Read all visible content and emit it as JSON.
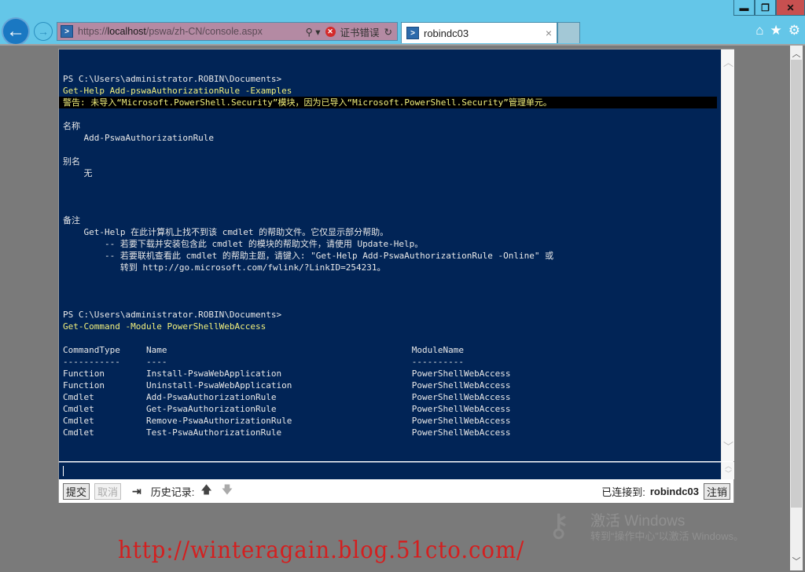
{
  "browser": {
    "window_controls": {
      "minimize": "▬",
      "restore": "❐",
      "close": "✕"
    },
    "address_bar": {
      "url_prefix": "https://",
      "url_host": "localhost",
      "url_path": "/pswa/zh-CN/console.aspx",
      "cert_error_label": "证书错误",
      "site_icon": "powershell-icon"
    },
    "tab": {
      "title": "robindc03",
      "close": "×"
    },
    "toolbar_icons": [
      "home-icon",
      "favorites-star-icon",
      "settings-gear-icon"
    ]
  },
  "console": {
    "lines": [
      {
        "type": "out",
        "text": "PS C:\\Users\\administrator.ROBIN\\Documents>"
      },
      {
        "type": "cmd",
        "text": "Get-Help Add-pswaAuthorizationRule -Examples"
      },
      {
        "type": "warn",
        "text": "警告: 未导入“Microsoft.PowerShell.Security”模块，因为已导入“Microsoft.PowerShell.Security”管理单元。"
      },
      {
        "type": "out",
        "text": ""
      },
      {
        "type": "out",
        "text": "名称"
      },
      {
        "type": "out",
        "text": "    Add-PswaAuthorizationRule"
      },
      {
        "type": "out",
        "text": ""
      },
      {
        "type": "out",
        "text": "别名"
      },
      {
        "type": "out",
        "text": "    无"
      },
      {
        "type": "out",
        "text": ""
      },
      {
        "type": "out",
        "text": ""
      },
      {
        "type": "out",
        "text": ""
      },
      {
        "type": "out",
        "text": "备注"
      },
      {
        "type": "out",
        "text": "    Get-Help 在此计算机上找不到该 cmdlet 的帮助文件。它仅显示部分帮助。"
      },
      {
        "type": "out",
        "text": "        -- 若要下载并安装包含此 cmdlet 的模块的帮助文件，请使用 Update-Help。"
      },
      {
        "type": "out",
        "text": "        -- 若要联机查看此 cmdlet 的帮助主题，请键入: \"Get-Help Add-PswaAuthorizationRule -Online\" 或"
      },
      {
        "type": "out",
        "text": "           转到 http://go.microsoft.com/fwlink/?LinkID=254231。"
      },
      {
        "type": "out",
        "text": ""
      },
      {
        "type": "out",
        "text": ""
      },
      {
        "type": "out",
        "text": ""
      },
      {
        "type": "out",
        "text": "PS C:\\Users\\administrator.ROBIN\\Documents>"
      },
      {
        "type": "cmd",
        "text": "Get-Command -Module PowerShellWebAccess"
      },
      {
        "type": "out",
        "text": ""
      },
      {
        "type": "out",
        "text": "CommandType     Name                                               ModuleName"
      },
      {
        "type": "out",
        "text": "-----------     ----                                               ----------"
      },
      {
        "type": "out",
        "text": "Function        Install-PswaWebApplication                         PowerShellWebAccess"
      },
      {
        "type": "out",
        "text": "Function        Uninstall-PswaWebApplication                       PowerShellWebAccess"
      },
      {
        "type": "out",
        "text": "Cmdlet          Add-PswaAuthorizationRule                          PowerShellWebAccess"
      },
      {
        "type": "out",
        "text": "Cmdlet          Get-PswaAuthorizationRule                          PowerShellWebAccess"
      },
      {
        "type": "out",
        "text": "Cmdlet          Remove-PswaAuthorizationRule                       PowerShellWebAccess"
      },
      {
        "type": "out",
        "text": "Cmdlet          Test-PswaAuthorizationRule                         PowerShellWebAccess"
      },
      {
        "type": "out",
        "text": ""
      },
      {
        "type": "out",
        "text": ""
      },
      {
        "type": "out",
        "text": "PS C:\\Users\\administrator.ROBIN\\Documents>"
      }
    ],
    "input_value": "",
    "toolbar": {
      "submit_label": "提交",
      "cancel_label": "取消",
      "tab_complete_icon": "⇥",
      "history_label": "历史记录:",
      "history_up": "🡅",
      "history_down": "🡇",
      "connected_label": "已连接到:",
      "connected_host": "robindc03",
      "logout_label": "注销"
    }
  },
  "watermarks": {
    "activate_title": "激活 Windows",
    "activate_sub": "转到“操作中心”以激活 Windows。",
    "blog_url": "http://winteragain.blog.51cto.com/"
  },
  "colors": {
    "console_bg": "#012456",
    "command_text": "#f2f07c",
    "chrome_bg": "#64c6e8",
    "watermark_red": "#d41f1f"
  }
}
